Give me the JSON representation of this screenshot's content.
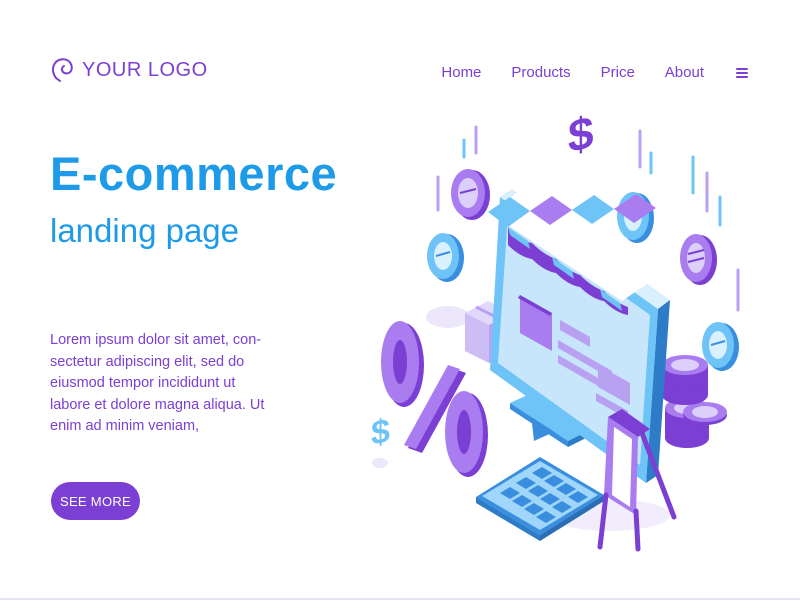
{
  "brand": {
    "logo_text": "YOUR LOGO",
    "logo_icon": "brain-icon"
  },
  "nav": {
    "items": [
      {
        "label": "Home"
      },
      {
        "label": "Products"
      },
      {
        "label": "Price"
      },
      {
        "label": "About"
      }
    ],
    "menu_icon": "hamburger-icon"
  },
  "hero": {
    "title": "E-commerce",
    "subtitle": "landing page",
    "body": "Lorem ipsum dolor sit amet, con-\nsectetur adipiscing elit, sed do\neiusmod tempor incididunt ut\nlabore et dolore magna aliqua. Ut\nenim ad minim veniam,",
    "cta_label": "SEE MORE"
  },
  "colors": {
    "primary": "#7b3fd4",
    "accent": "#1e9be8",
    "light_blue": "#6ec3f7",
    "lavender": "#b9a1f2",
    "background": "#ffffff"
  }
}
